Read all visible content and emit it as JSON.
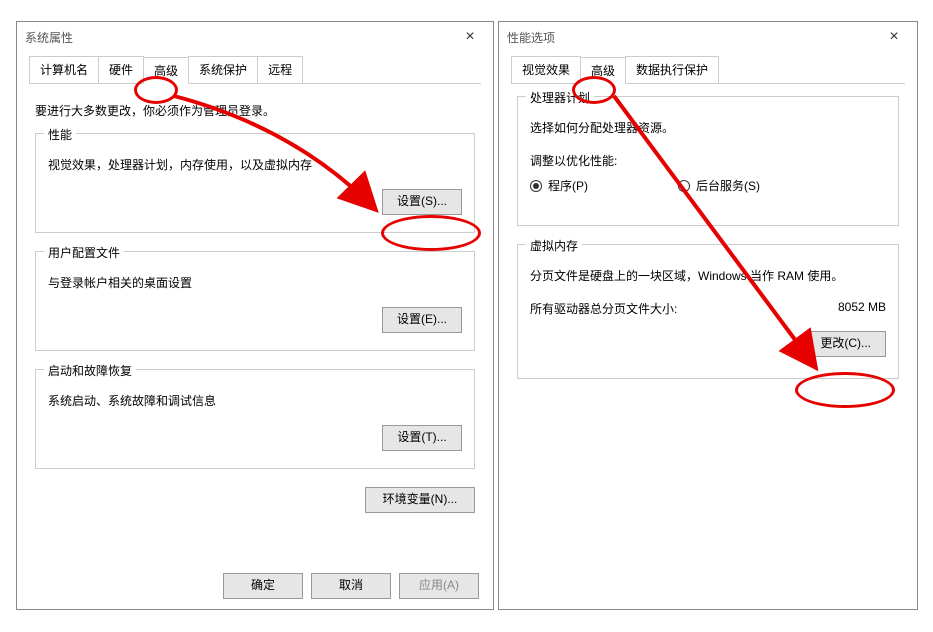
{
  "left": {
    "title": "系统属性",
    "tabs": [
      "计算机名",
      "硬件",
      "高级",
      "系统保护",
      "远程"
    ],
    "selectedTab": "高级",
    "admin_note": "要进行大多数更改，你必须作为管理员登录。",
    "performance": {
      "legend": "性能",
      "desc": "视觉效果，处理器计划，内存使用，以及虚拟内存",
      "settings_btn": "设置(S)..."
    },
    "userprofile": {
      "legend": "用户配置文件",
      "desc": "与登录帐户相关的桌面设置",
      "settings_btn": "设置(E)..."
    },
    "startup": {
      "legend": "启动和故障恢复",
      "desc": "系统启动、系统故障和调试信息",
      "settings_btn": "设置(T)..."
    },
    "env_btn": "环境变量(N)...",
    "footer": {
      "ok": "确定",
      "cancel": "取消",
      "apply": "应用(A)"
    }
  },
  "right": {
    "title": "性能选项",
    "tabs": [
      "视觉效果",
      "高级",
      "数据执行保护"
    ],
    "selectedTab": "高级",
    "processor": {
      "legend": "处理器计划",
      "desc": "选择如何分配处理器资源。",
      "adjust_label": "调整以优化性能:",
      "radio_programs": "程序(P)",
      "radio_background": "后台服务(S)"
    },
    "vm": {
      "legend": "虚拟内存",
      "desc": "分页文件是硬盘上的一块区域，Windows 当作 RAM 使用。",
      "total_label": "所有驱动器总分页文件大小:",
      "total_value": "8052 MB",
      "change_btn": "更改(C)..."
    }
  }
}
